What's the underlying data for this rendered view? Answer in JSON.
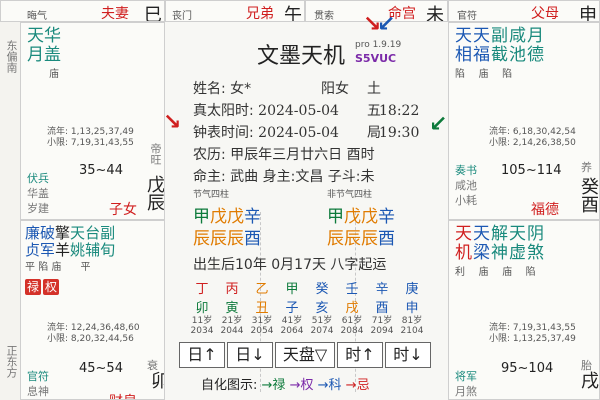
{
  "top_row": {
    "left_fragment": "晦气",
    "left_palace": "夫妻",
    "left_branch": "巳",
    "mid_fragment": "丧门",
    "mid_palace": "兄弟",
    "mid_branch": "午",
    "right_fragment": "贯索",
    "right_palace": "命宫",
    "right_branch": "未",
    "far_right_fragment": "官符",
    "far_right_palace": "父母",
    "far_right_branch": "申"
  },
  "side_labels": {
    "left_top": "东偏南",
    "left_bottom": "正东方"
  },
  "left_cell": {
    "stars_top": [
      "天",
      "华"
    ],
    "stars_bottom": [
      "月",
      "盖"
    ],
    "star_level": "庙",
    "flow_year": "流年: 1,13,25,37,49",
    "small_limit": "小限: 7,19,31,43,55",
    "age_range": "35~44",
    "gods": [
      "伏兵",
      "华盖",
      "岁建"
    ],
    "life_stage": "帝旺",
    "palace": "子女",
    "branch": "戊辰"
  },
  "right_cell": {
    "stars_top": [
      "天",
      "天",
      "副",
      "咸",
      "月"
    ],
    "stars_bottom": [
      "相",
      "福",
      "截",
      "池",
      "德"
    ],
    "levels": [
      "陷",
      "庙",
      "陷"
    ],
    "flow_year": "流年: 6,18,30,42,54",
    "small_limit": "小限: 2,14,26,38,50",
    "age_range": "105~114",
    "gods": [
      "奏书",
      "咸池",
      "小耗"
    ],
    "life_stage": "养",
    "palace": "福德",
    "branch": "癸酉"
  },
  "lower_left_cell": {
    "stars_top": [
      "廉",
      "破",
      "擎",
      "天",
      "台",
      "副"
    ],
    "stars_bottom": [
      "贞",
      "军",
      "羊",
      "姚",
      "辅",
      "旬"
    ],
    "levels": [
      "平",
      "陷",
      "庙",
      "平"
    ],
    "transform_badges": [
      "禄",
      "权"
    ],
    "flow_year": "流年: 12,24,36,48,60",
    "small_limit": "小限: 8,20,32,44,56",
    "age_range": "45~54",
    "gods": [
      "官符",
      "息神"
    ],
    "life_stage": "衰",
    "branch": "丁卯",
    "palace_hidden": "财帛"
  },
  "lower_right_cell": {
    "stars_top": [
      "天",
      "天",
      "解",
      "天",
      "阴"
    ],
    "stars_bottom": [
      "机",
      "梁",
      "神",
      "虚",
      "煞"
    ],
    "levels": [
      "利",
      "庙",
      "庙",
      "陷"
    ],
    "flow_year": "流年: 7,19,31,43,55",
    "small_limit": "小限: 1,13,25,37,49",
    "age_range": "95~104",
    "gods": [
      "将军",
      "月煞"
    ],
    "life_stage": "胎",
    "branch": "甲戌"
  },
  "center": {
    "title": "文墨天机",
    "version": "pro 1.9.19",
    "code": "S5VUC",
    "name_label": "姓名: 女*",
    "yang_label": "阳女",
    "bureau": "土五局",
    "true_solar_label": "真太阳时:",
    "true_solar_value": "2024-05-04",
    "true_solar_time": "18:22",
    "clock_label": "钟表时间:",
    "clock_value": "2024-05-04",
    "clock_time": "19:30",
    "lunar": "农历: 甲辰年三月廿六日 酉时",
    "ming": "命主: 武曲  身主:文昌  子斗:未",
    "jieqi_label": "节气四柱",
    "non_jieqi_label": "非节气四柱",
    "pillars_left_stems": [
      "甲",
      "戊",
      "戊",
      "辛"
    ],
    "pillars_left_branches": [
      "辰",
      "辰",
      "辰",
      "酉"
    ],
    "pillars_right_stems": [
      "甲",
      "戊",
      "戊",
      "辛"
    ],
    "pillars_right_branches": [
      "辰",
      "辰",
      "辰",
      "酉"
    ],
    "qiyun": "出生后10年 0月17天 八字起运",
    "dayun_stems": [
      "丁",
      "丙",
      "乙",
      "甲",
      "癸",
      "壬",
      "辛",
      "庚"
    ],
    "dayun_branches": [
      "卯",
      "寅",
      "丑",
      "子",
      "亥",
      "戌",
      "酉",
      "申"
    ],
    "dayun_ages": [
      "11岁",
      "21岁",
      "31岁",
      "41岁",
      "51岁",
      "61岁",
      "71岁",
      "81岁"
    ],
    "dayun_years": [
      "2034",
      "2044",
      "2054",
      "2064",
      "2074",
      "2084",
      "2094",
      "2104"
    ],
    "buttons": [
      "日↑",
      "日↓",
      "天盘▽",
      "时↑",
      "时↓"
    ],
    "legend_label": "自化图示:",
    "legend_items": [
      "→禄",
      "→权",
      "→科",
      "→忌"
    ],
    "colors": {
      "red": "#d01f1f",
      "blue": "#1c58b3",
      "green": "#0d7a3b",
      "orange": "#e07b00",
      "purple": "#7b2aa8"
    }
  }
}
